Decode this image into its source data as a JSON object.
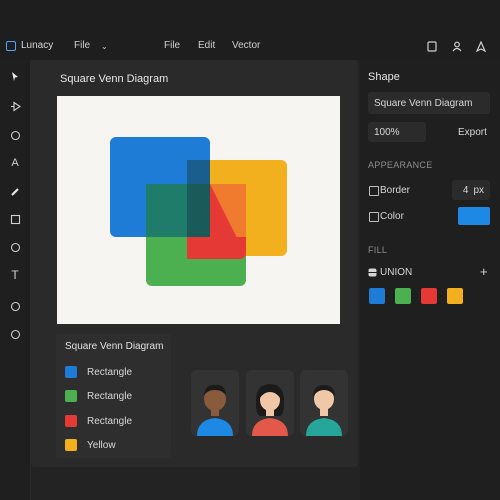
{
  "app": {
    "name": "Lunacy"
  },
  "menubar": {
    "file_menu": "File",
    "file": "File",
    "edit": "Edit",
    "vector": "Vector"
  },
  "workspace": {
    "title": "Square Venn Diagram"
  },
  "legend": {
    "title": "Square Venn Diagram",
    "items": [
      {
        "label": "Rectangle",
        "color": "#1e7bd6"
      },
      {
        "label": "Rectangle",
        "color": "#4caf50"
      },
      {
        "label": "Rectangle",
        "color": "#e53935"
      },
      {
        "label": "Yellow",
        "color": "#f2b01e"
      }
    ]
  },
  "right_panel": {
    "heading": "Shape",
    "name_value": "Square Venn Diagram",
    "zoom": "100%",
    "export": "Export",
    "appearance_label": "APPEARANCE",
    "border_label": "Border",
    "border_value": "4",
    "border_unit": "px",
    "color_label": "Color",
    "color_value": "#1e88e5",
    "fill_label": "FILL",
    "union_label": "UNION",
    "add": "+",
    "fill_swatches": [
      "#1e7bd6",
      "#4caf50",
      "#e53935",
      "#f2b01e"
    ]
  },
  "colors": {
    "blue": "#1e88e5",
    "green": "#4caf50",
    "red": "#e53935",
    "yellow": "#f2b01e",
    "overlap": "#f07a2e"
  },
  "icons": [
    "app-logo-icon",
    "chevron-down-icon",
    "file-icon",
    "user-icon",
    "share-icon",
    "pointer-icon",
    "direct-select-icon",
    "ellipse-icon",
    "text-a-icon",
    "pencil-icon",
    "rectangle-icon",
    "circle-icon",
    "text-icon",
    "circle-icon",
    "circle-icon",
    "union-icon",
    "add-icon"
  ]
}
